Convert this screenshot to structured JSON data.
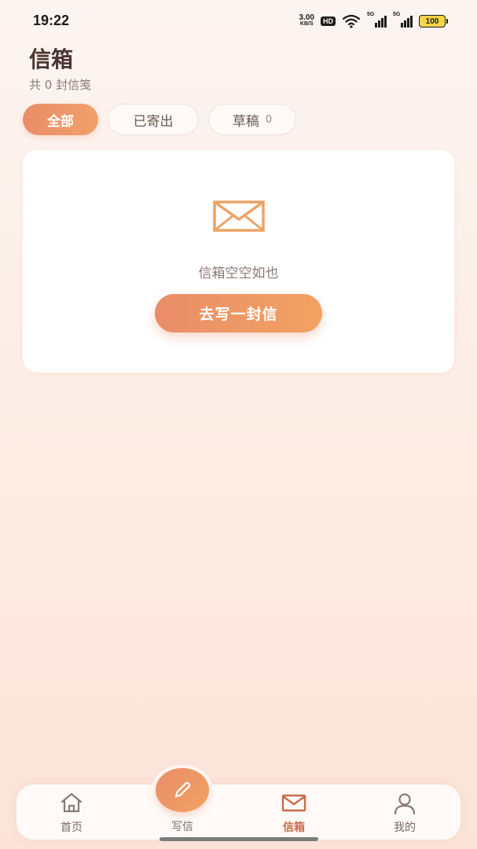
{
  "status_bar": {
    "time": "19:22",
    "net_speed_value": "3.00",
    "net_speed_unit": "KB/S",
    "hd_label": "HD",
    "signal_1_label": "5G",
    "signal_2_label": "5G",
    "battery_level": "100"
  },
  "header": {
    "title": "信箱",
    "subtitle": "共 0 封信笺"
  },
  "tabs": [
    {
      "label": "全部",
      "count": "",
      "active": true
    },
    {
      "label": "已寄出",
      "count": "",
      "active": false
    },
    {
      "label": "草稿",
      "count": "0",
      "active": false
    }
  ],
  "empty_state": {
    "icon": "envelope-icon",
    "message": "信箱空空如也",
    "button_label": "去写一封信"
  },
  "bottom_nav": {
    "items": [
      {
        "label": "首页",
        "icon": "home-icon"
      },
      {
        "label": "写信",
        "icon": "pencil-icon"
      },
      {
        "label": "信箱",
        "icon": "envelope-icon",
        "active": true
      },
      {
        "label": "我的",
        "icon": "user-icon"
      }
    ]
  },
  "colors": {
    "accent": "#e98d69",
    "accent_light": "#f2a262",
    "background": "#fcece4",
    "card": "#ffffff",
    "active_nav": "#c86a4b"
  }
}
